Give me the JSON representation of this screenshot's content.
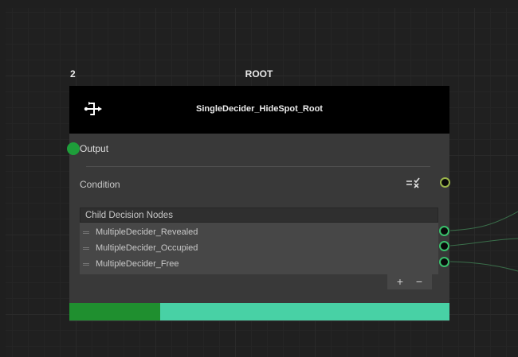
{
  "node": {
    "index": "2",
    "role": "ROOT",
    "title": "SingleDecider_HideSpot_Root",
    "icon": "flow-branch-icon"
  },
  "ports": {
    "output_label": "Output",
    "condition_label": "Condition"
  },
  "child_list": {
    "header": "Child Decision Nodes",
    "items": [
      {
        "label": "MultipleDecider_Revealed"
      },
      {
        "label": "MultipleDecider_Occupied"
      },
      {
        "label": "MultipleDecider_Free"
      }
    ],
    "add_label": "+",
    "remove_label": "−"
  },
  "progress": {
    "fraction": 0.24
  },
  "colors": {
    "port_output": "#1e9e3a",
    "port_child": "#39c06b",
    "port_condition": "#9ab54a",
    "progress_fill": "#1f8f2f",
    "progress_track": "#48d1a5"
  }
}
